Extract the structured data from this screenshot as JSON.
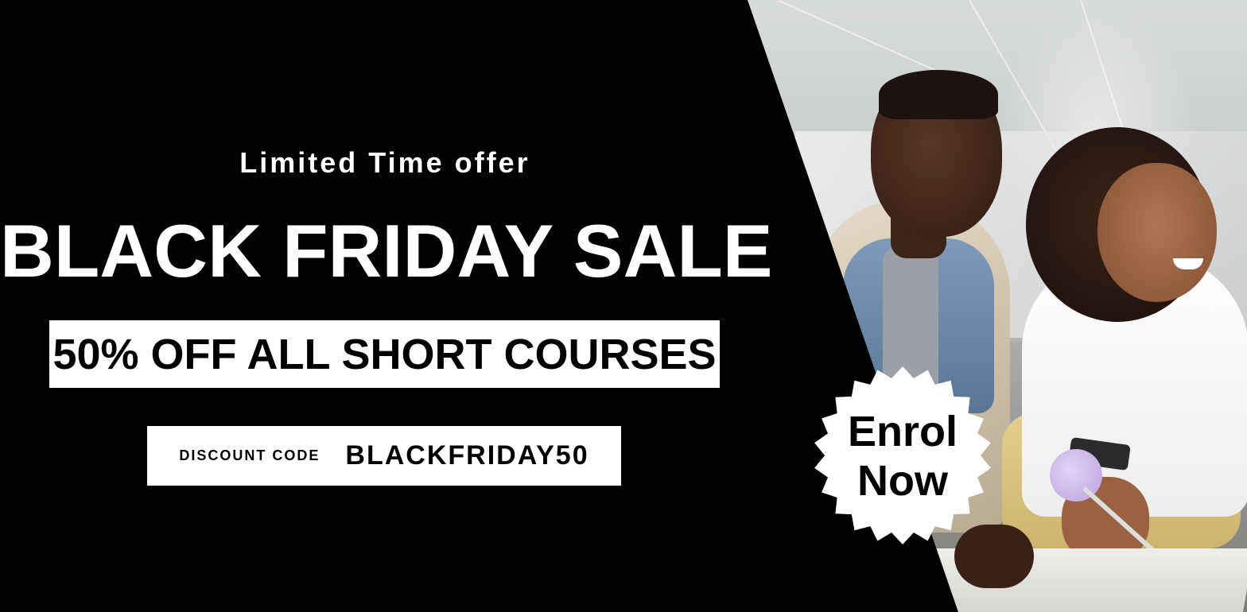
{
  "tagline": "Limited Time offer",
  "title": "BLACK FRIDAY SALE",
  "offer": "50% OFF ALL SHORT COURSES",
  "discount": {
    "label": "DISCOUNT CODE",
    "code": "BLACKFRIDAY50"
  },
  "cta": {
    "line1": "Enrol",
    "line2": "Now"
  },
  "colors": {
    "background": "#000000",
    "text": "#ffffff",
    "box": "#ffffff",
    "box_text": "#000000",
    "badge": "#ffffff"
  }
}
